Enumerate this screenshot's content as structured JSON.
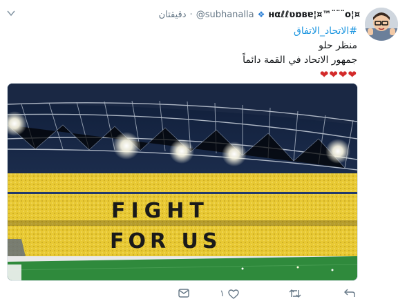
{
  "user": {
    "display_name": "¤¦ʜαℓℓʋɒвɐ¦¤™¨¨¨o",
    "handle": "@subhanalla",
    "time": "دقيقتان",
    "separator": "·"
  },
  "tweet": {
    "hashtag": "#الاتحاد_الاتفاق",
    "line1": "منظر حلو",
    "line2": "جمهور الاتحاد في القمة دائماً",
    "hearts": "❤❤❤❤"
  },
  "media": {
    "stand_text_line1": "FIGHT",
    "stand_text_line2": "FOR US"
  },
  "actions": {
    "like_count": "١"
  },
  "colors": {
    "link": "#1b95e0",
    "muted": "#657786",
    "heart": "#d32a2a",
    "gold": "#f2d23c",
    "pitch": "#2f8a3c"
  }
}
